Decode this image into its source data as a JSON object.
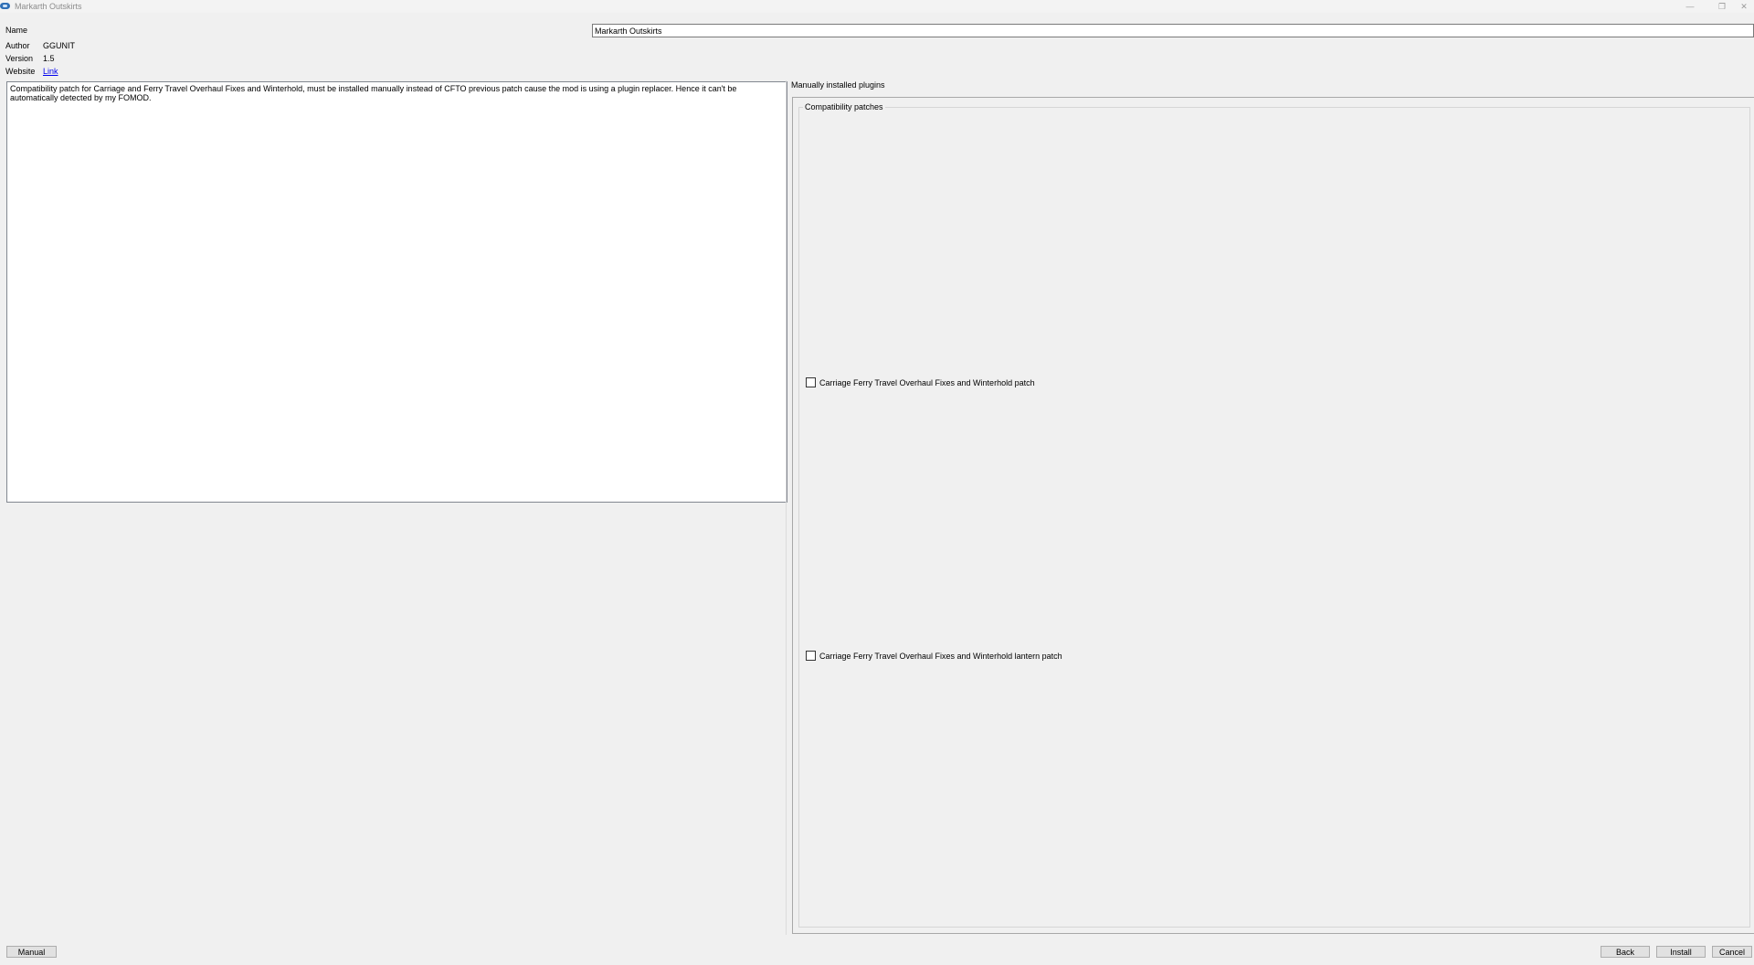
{
  "window": {
    "title": "Markarth Outskirts",
    "minimize_glyph": "—",
    "maximize_glyph": "❐",
    "close_glyph": "✕",
    "app_icon": "mod-organizer-icon"
  },
  "info": {
    "name_label": "Name",
    "name_value": "Markarth Outskirts",
    "author_label": "Author",
    "author_value": "GGUNIT",
    "version_label": "Version",
    "version_value": "1.5",
    "website_label": "Website",
    "website_link": "Link"
  },
  "description": "Compatibility patch for Carriage and  Ferry Travel Overhaul Fixes and Winterhold, must be installed manually instead of CFTO previous patch cause the mod is using a plugin replacer. Hence it can't be automatically detected by my FOMOD.",
  "step": {
    "title": "Manually installed plugins",
    "group": {
      "title": "Compatibility patches",
      "options": [
        {
          "label": "Carriage Ferry Travel Overhaul Fixes and Winterhold patch",
          "checked": false
        },
        {
          "label": "Carriage Ferry Travel Overhaul Fixes and Winterhold lantern patch",
          "checked": false
        }
      ]
    }
  },
  "buttons": {
    "manual": "Manual",
    "back": "Back",
    "install": "Install",
    "cancel": "Cancel"
  }
}
